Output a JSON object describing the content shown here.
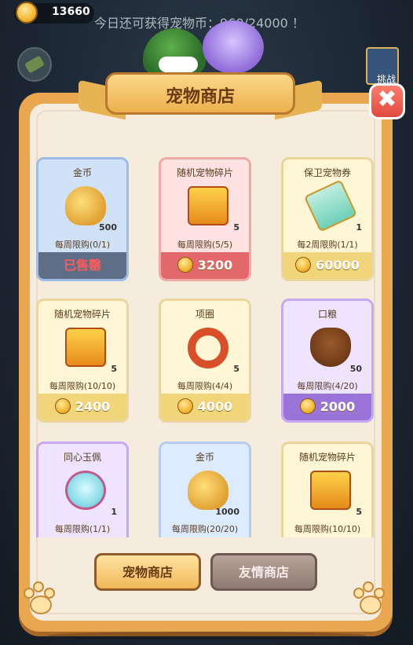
{
  "topbar": {
    "coin_amount": "13660",
    "notice": "今日还可获得宠物币：960/24000 ！",
    "right_flag_label": "挑战"
  },
  "dialog": {
    "title": "宠物商店",
    "close_symbol": "✖"
  },
  "items": [
    {
      "name": "金币",
      "limit": "每周限购(0/1)",
      "qty": "500",
      "price": "已售罄",
      "style": "blue",
      "sold": true,
      "icon": "gold-coins-icon"
    },
    {
      "name": "随机宠物碎片",
      "limit": "每周限购(5/5)",
      "qty": "5",
      "price": "3200",
      "style": "red",
      "sold": false,
      "icon": "treasure-chest-icon"
    },
    {
      "name": "保卫宠物券",
      "limit": "每2周限购(1/1)",
      "qty": "1",
      "price": "60000",
      "style": "gold",
      "sold": false,
      "icon": "ticket-icon"
    },
    {
      "name": "随机宠物碎片",
      "limit": "每周限购(10/10)",
      "qty": "5",
      "price": "2400",
      "style": "gold",
      "sold": false,
      "icon": "treasure-chest-icon"
    },
    {
      "name": "项圈",
      "limit": "每周限购(4/4)",
      "qty": "5",
      "price": "4000",
      "style": "gold",
      "sold": false,
      "icon": "collar-icon"
    },
    {
      "name": "口粮",
      "limit": "每周限购(4/20)",
      "qty": "50",
      "price": "2000",
      "style": "purple",
      "sold": false,
      "icon": "pet-food-icon"
    },
    {
      "name": "同心玉佩",
      "limit": "每周限购(1/1)",
      "qty": "1",
      "price": "",
      "style": "purple",
      "sold": false,
      "icon": "jade-pendant-icon"
    },
    {
      "name": "金币",
      "limit": "每周限购(20/20)",
      "qty": "1000",
      "price": "",
      "style": "lightblue",
      "sold": false,
      "icon": "gold-coins-icon"
    },
    {
      "name": "随机宠物碎片",
      "limit": "每周限购(10/10)",
      "qty": "5",
      "price": "",
      "style": "gold",
      "sold": false,
      "icon": "treasure-chest-icon"
    }
  ],
  "tabs": {
    "pet_shop": "宠物商店",
    "friend_shop": "友情商店"
  },
  "colors": {
    "panel_border": "#e9a850",
    "panel_bg": "#f6ecdd",
    "close_red": "#e04a3e",
    "price_gold": "#f1d57a",
    "sold_out_red": "#ff5b5b"
  }
}
